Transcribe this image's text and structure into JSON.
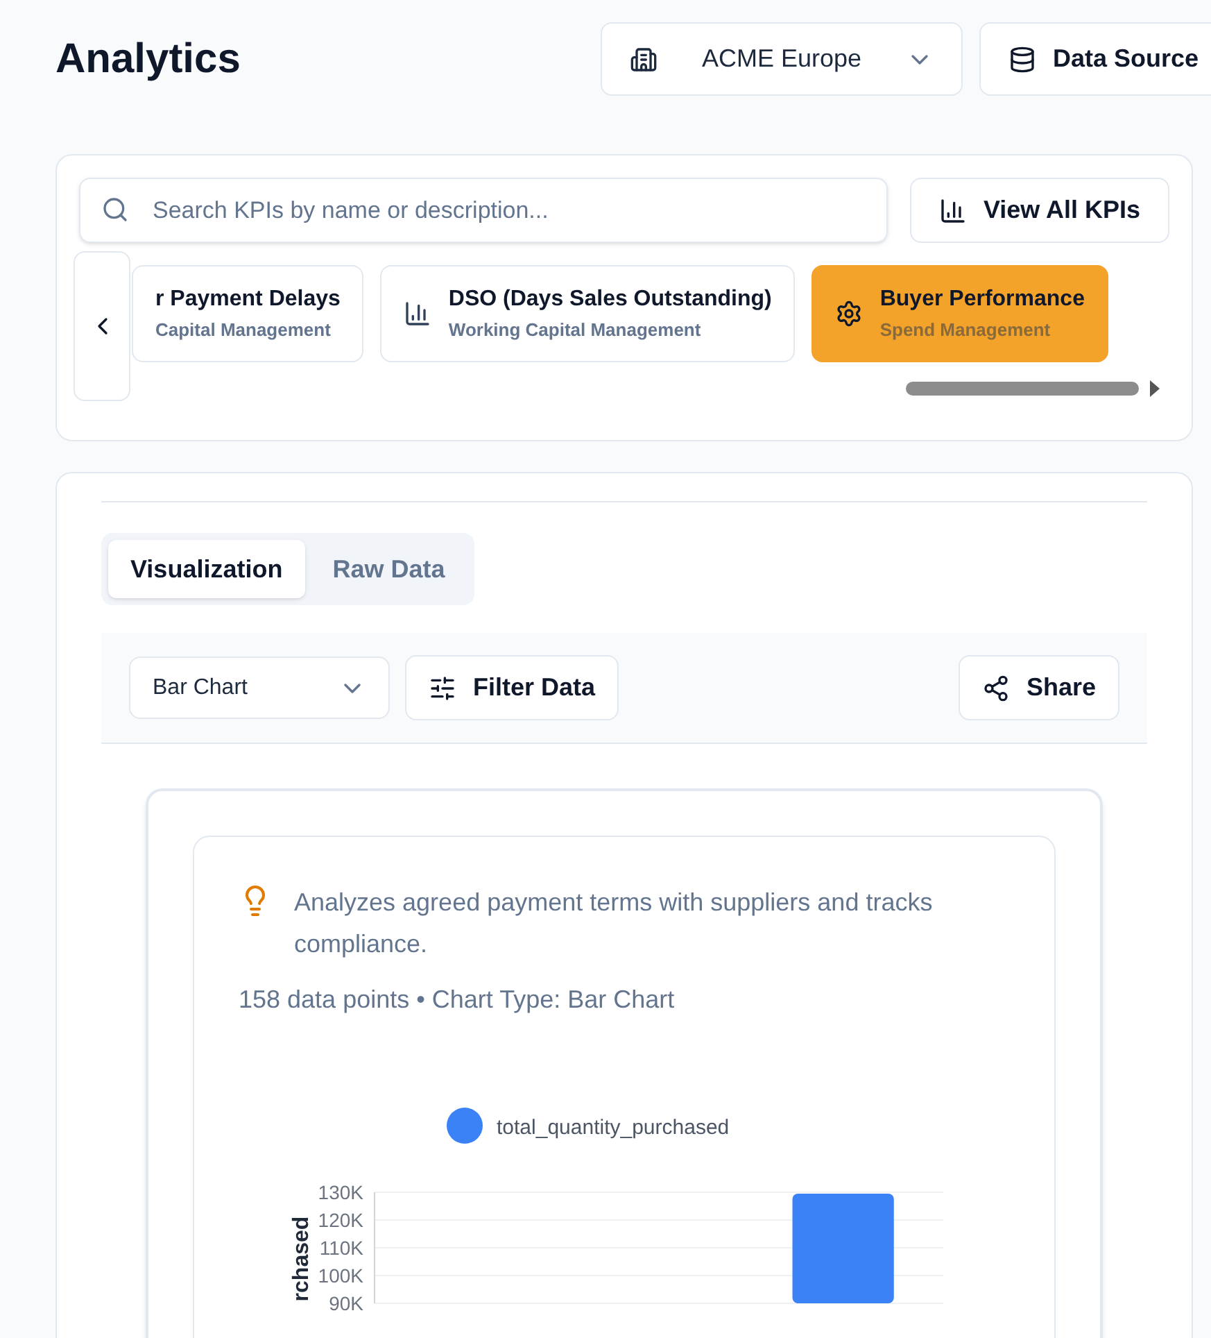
{
  "header": {
    "title": "Analytics",
    "organization": "ACME Europe",
    "data_source_button": "Data Source"
  },
  "kpi_picker": {
    "search": {
      "placeholder": "Search KPIs by name or description..."
    },
    "view_all_button": "View All KPIs",
    "kpis": [
      {
        "name": "r Payment Delays",
        "category": "Capital Management",
        "selected": false
      },
      {
        "name": "DSO (Days Sales Outstanding)",
        "category": "Working Capital Management",
        "selected": false
      },
      {
        "name": "Buyer Performance",
        "category": "Spend Management",
        "selected": true
      }
    ]
  },
  "view": {
    "tabs": [
      {
        "label": "Visualization",
        "selected": true
      },
      {
        "label": "Raw Data",
        "selected": false
      }
    ],
    "chart_type": "Bar Chart",
    "filter_button": "Filter Data",
    "share_button": "Share",
    "description": "Analyzes agreed payment terms with suppliers and tracks compliance.",
    "summary": "158 data points • Chart Type: Bar Chart",
    "chart_data": {
      "type": "bar",
      "ylabel": "rchased",
      "yticks": [
        {
          "value": 90000,
          "label": "90K"
        },
        {
          "value": 100000,
          "label": "100K"
        },
        {
          "value": 110000,
          "label": "110K"
        },
        {
          "value": 120000,
          "label": "120K"
        },
        {
          "value": 130000,
          "label": "130K"
        }
      ],
      "grid": true,
      "ylim": [
        90000,
        130000
      ],
      "series": [
        {
          "name": "total_quantity_purchased",
          "color": "#3b82f6",
          "values": [
            null,
            null,
            null,
            129500
          ]
        }
      ]
    }
  }
}
